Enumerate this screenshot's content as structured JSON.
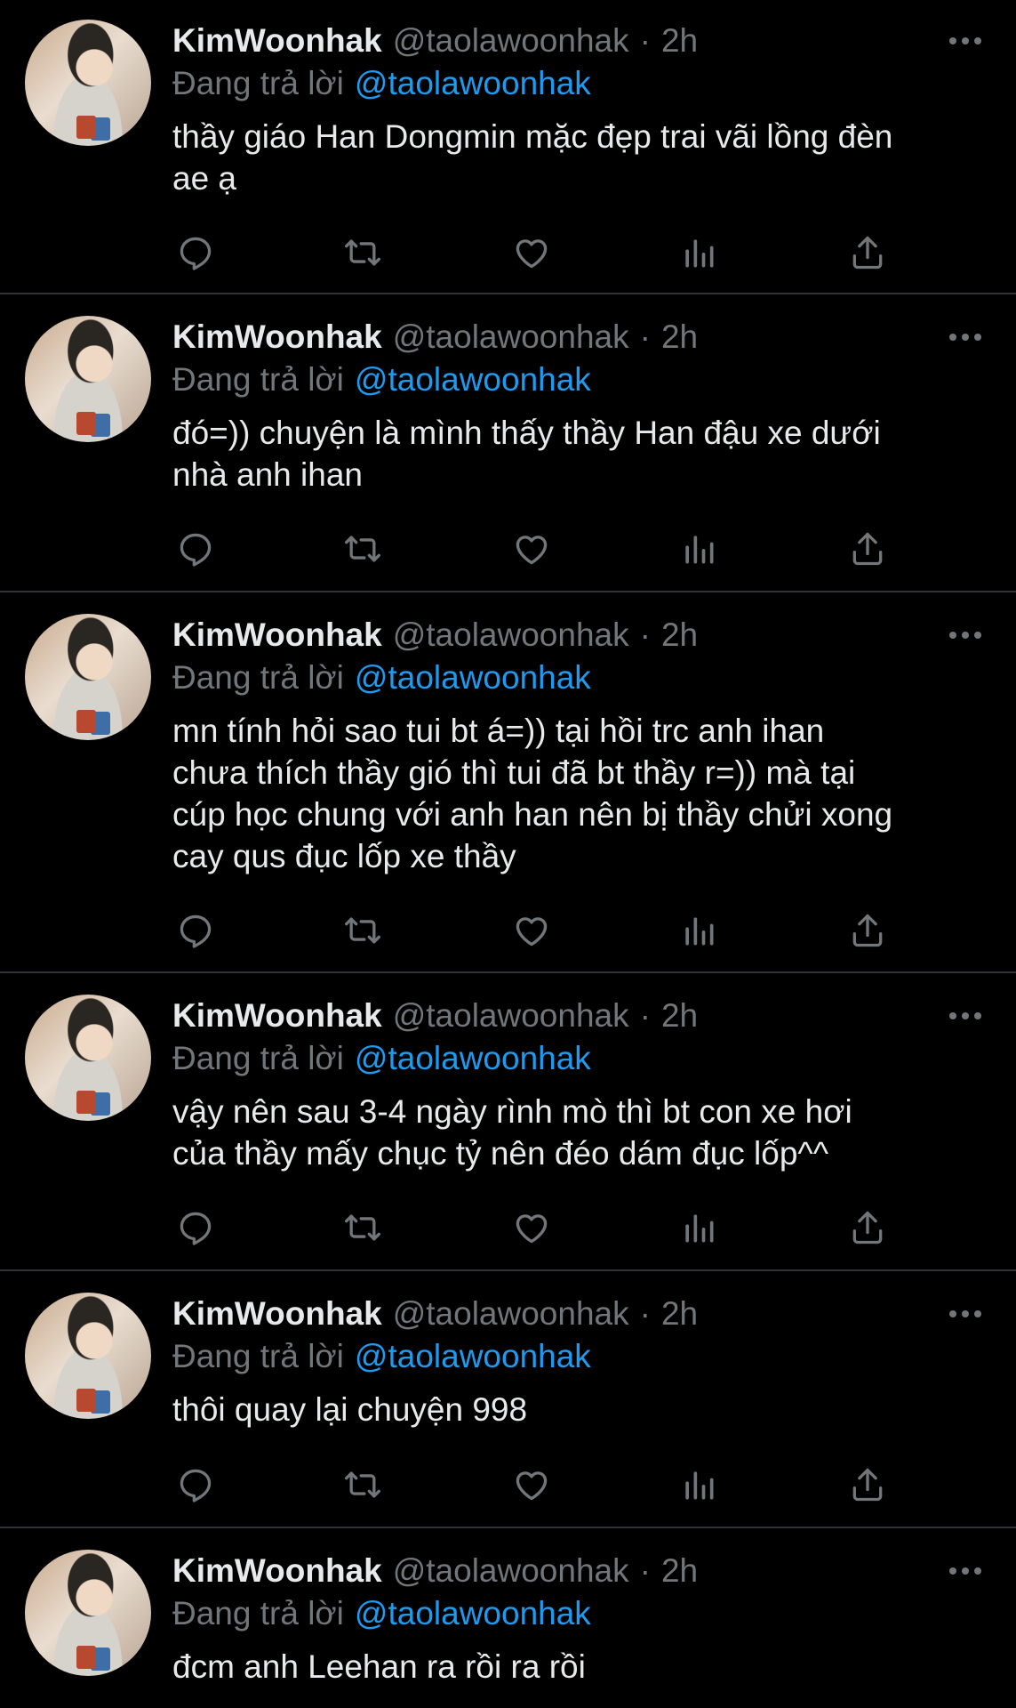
{
  "colors": {
    "background": "#000000",
    "text": "#e7e9ea",
    "muted": "#71767b",
    "accent": "#1d9bf0",
    "divider": "#2f3336"
  },
  "tweets": [
    {
      "name": "KimWoonhak",
      "handle": "@taolawoonhak",
      "separator": "·",
      "time": "2h",
      "replying_label": "Đang trả lời",
      "replying_to": "@taolawoonhak",
      "text": "thầy giáo Han Dongmin mặc đẹp trai vãi lồng đèn\nae ạ"
    },
    {
      "name": "KimWoonhak",
      "handle": "@taolawoonhak",
      "separator": "·",
      "time": "2h",
      "replying_label": "Đang trả lời",
      "replying_to": "@taolawoonhak",
      "text": "đó=)) chuyện là mình thấy thầy Han đậu xe dưới\nnhà anh ihan"
    },
    {
      "name": "KimWoonhak",
      "handle": "@taolawoonhak",
      "separator": "·",
      "time": "2h",
      "replying_label": "Đang trả lời",
      "replying_to": "@taolawoonhak",
      "text": "mn tính hỏi sao tui bt á=)) tại hồi trc anh ihan\nchưa thích thầy gió thì tui đã bt thầy r=)) mà tại\ncúp học chung với anh han nên bị thầy chửi xong\ncay qus đục lốp xe thầy"
    },
    {
      "name": "KimWoonhak",
      "handle": "@taolawoonhak",
      "separator": "·",
      "time": "2h",
      "replying_label": "Đang trả lời",
      "replying_to": "@taolawoonhak",
      "text": "vậy nên sau 3-4 ngày rình mò thì bt con xe hơi\ncủa thầy mấy chục tỷ nên đéo dám đục lốp^^"
    },
    {
      "name": "KimWoonhak",
      "handle": "@taolawoonhak",
      "separator": "·",
      "time": "2h",
      "replying_label": "Đang trả lời",
      "replying_to": "@taolawoonhak",
      "text": "thôi quay lại chuyện 998"
    },
    {
      "name": "KimWoonhak",
      "handle": "@taolawoonhak",
      "separator": "·",
      "time": "2h",
      "replying_label": "Đang trả lời",
      "replying_to": "@taolawoonhak",
      "text": "đcm anh Leehan ra rồi ra rồi"
    }
  ],
  "icons": {
    "more": "more-horizontal-icon",
    "reply": "reply-icon",
    "retweet": "retweet-icon",
    "like": "heart-icon",
    "views": "views-icon",
    "share": "share-icon"
  }
}
